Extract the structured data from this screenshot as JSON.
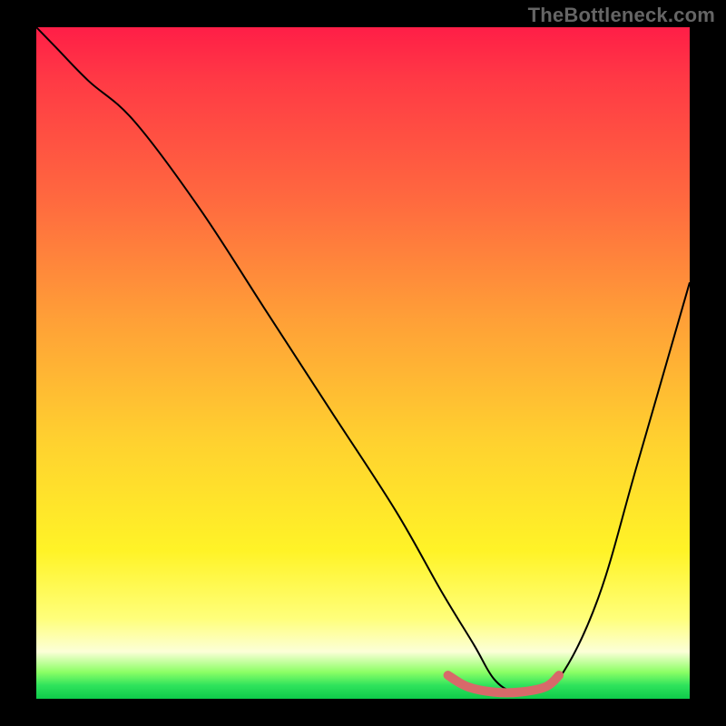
{
  "watermark": "TheBottleneck.com",
  "chart_data": {
    "type": "line",
    "title": "",
    "xlabel": "",
    "ylabel": "",
    "xlim": [
      0,
      100
    ],
    "ylim": [
      0,
      100
    ],
    "grid": false,
    "legend": false,
    "annotations": [],
    "series": [
      {
        "name": "bottleneck-curve",
        "color": "#000000",
        "x": [
          0,
          3,
          8,
          15,
          25,
          35,
          45,
          55,
          62,
          67,
          70,
          73,
          76,
          80,
          86,
          92,
          100
        ],
        "y": [
          100,
          97,
          92,
          86,
          73,
          58,
          43,
          28,
          16,
          8,
          3,
          1,
          1,
          3,
          15,
          35,
          62
        ]
      }
    ],
    "markers": [
      {
        "name": "optimal-range",
        "color": "#d8696a",
        "x": [
          63,
          66,
          70,
          74,
          78,
          80
        ],
        "y": [
          3.5,
          1.8,
          1.0,
          1.0,
          1.8,
          3.5
        ]
      }
    ],
    "background_gradient": {
      "direction": "vertical",
      "stops": [
        {
          "pos": 0.0,
          "color": "#ff1e47"
        },
        {
          "pos": 0.26,
          "color": "#ff6a3f"
        },
        {
          "pos": 0.62,
          "color": "#ffd22f"
        },
        {
          "pos": 0.88,
          "color": "#ffff7a"
        },
        {
          "pos": 0.96,
          "color": "#8dff66"
        },
        {
          "pos": 1.0,
          "color": "#0ecb4a"
        }
      ]
    }
  }
}
